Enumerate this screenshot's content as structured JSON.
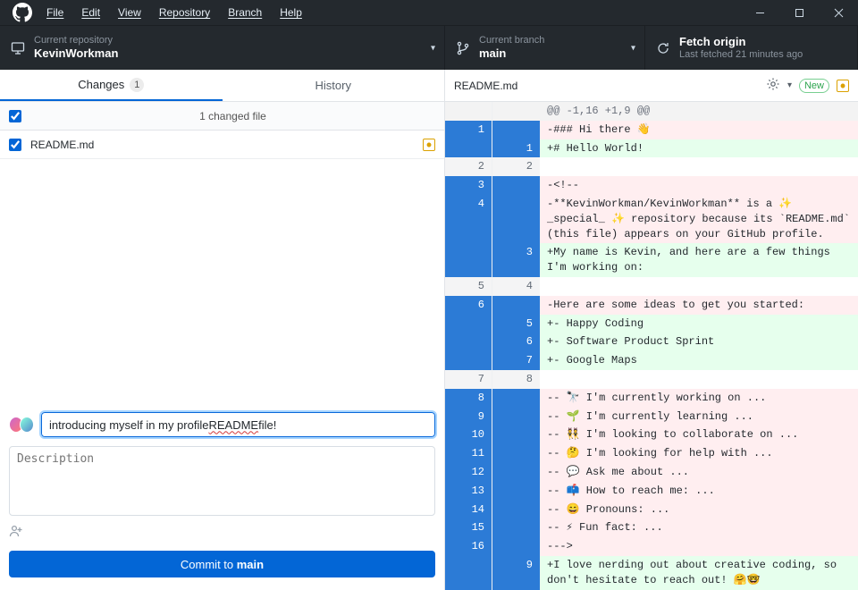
{
  "menu": [
    "File",
    "Edit",
    "View",
    "Repository",
    "Branch",
    "Help"
  ],
  "repo": {
    "title": "Current repository",
    "name": "KevinWorkman"
  },
  "branch": {
    "title": "Current branch",
    "name": "main"
  },
  "fetch": {
    "title": "Fetch origin",
    "sub": "Last fetched 21 minutes ago"
  },
  "tabs": {
    "changes": "Changes",
    "changes_count": "1",
    "history": "History"
  },
  "changed_header": "1 changed file",
  "file_list": [
    {
      "name": "README.md"
    }
  ],
  "commit": {
    "summary_value": "introducing myself in my profile README file!",
    "summary_underline_word": "README",
    "desc_placeholder": "Description",
    "button_prefix": "Commit to ",
    "button_branch": "main"
  },
  "diff_header": {
    "file": "README.md",
    "new": "New"
  },
  "diff": [
    {
      "kind": "hunk",
      "old": "",
      "new": "",
      "text": "@@ -1,16 +1,9 @@"
    },
    {
      "kind": "del",
      "sel": true,
      "old": "1",
      "new": "",
      "text": "-### Hi there 👋"
    },
    {
      "kind": "add",
      "sel": true,
      "old": "",
      "new": "1",
      "text": "+# Hello World!"
    },
    {
      "kind": "ctx",
      "old": "2",
      "new": "2",
      "text": " "
    },
    {
      "kind": "del",
      "sel": true,
      "old": "3",
      "new": "",
      "text": "-<!--"
    },
    {
      "kind": "del",
      "sel": true,
      "old": "4",
      "new": "",
      "text": "-**KevinWorkman/KevinWorkman** is a ✨ _special_ ✨ repository because its `README.md` (this file) appears on your GitHub profile."
    },
    {
      "kind": "add",
      "sel": true,
      "old": "",
      "new": "3",
      "text": "+My name is Kevin, and here are a few things I'm working on:"
    },
    {
      "kind": "ctx",
      "old": "5",
      "new": "4",
      "text": " "
    },
    {
      "kind": "del",
      "sel": true,
      "old": "6",
      "new": "",
      "text": "-Here are some ideas to get you started:"
    },
    {
      "kind": "add",
      "sel": true,
      "old": "",
      "new": "5",
      "text": "+- Happy Coding"
    },
    {
      "kind": "add",
      "sel": true,
      "old": "",
      "new": "6",
      "text": "+- Software Product Sprint"
    },
    {
      "kind": "add",
      "sel": true,
      "old": "",
      "new": "7",
      "text": "+- Google Maps"
    },
    {
      "kind": "ctx",
      "old": "7",
      "new": "8",
      "text": " "
    },
    {
      "kind": "del",
      "sel": true,
      "old": "8",
      "new": "",
      "text": "-- 🔭 I'm currently working on ..."
    },
    {
      "kind": "del",
      "sel": true,
      "old": "9",
      "new": "",
      "text": "-- 🌱 I'm currently learning ..."
    },
    {
      "kind": "del",
      "sel": true,
      "old": "10",
      "new": "",
      "text": "-- 👯 I'm looking to collaborate on ..."
    },
    {
      "kind": "del",
      "sel": true,
      "old": "11",
      "new": "",
      "text": "-- 🤔 I'm looking for help with ..."
    },
    {
      "kind": "del",
      "sel": true,
      "old": "12",
      "new": "",
      "text": "-- 💬 Ask me about ..."
    },
    {
      "kind": "del",
      "sel": true,
      "old": "13",
      "new": "",
      "text": "-- 📫 How to reach me: ..."
    },
    {
      "kind": "del",
      "sel": true,
      "old": "14",
      "new": "",
      "text": "-- 😄 Pronouns: ..."
    },
    {
      "kind": "del",
      "sel": true,
      "old": "15",
      "new": "",
      "text": "-- ⚡ Fun fact: ..."
    },
    {
      "kind": "del",
      "sel": true,
      "old": "16",
      "new": "",
      "text": "--->"
    },
    {
      "kind": "add",
      "sel": true,
      "old": "",
      "new": "9",
      "text": "+I love nerding out about creative coding, so don't hesitate to reach out! 🤗🤓"
    }
  ]
}
